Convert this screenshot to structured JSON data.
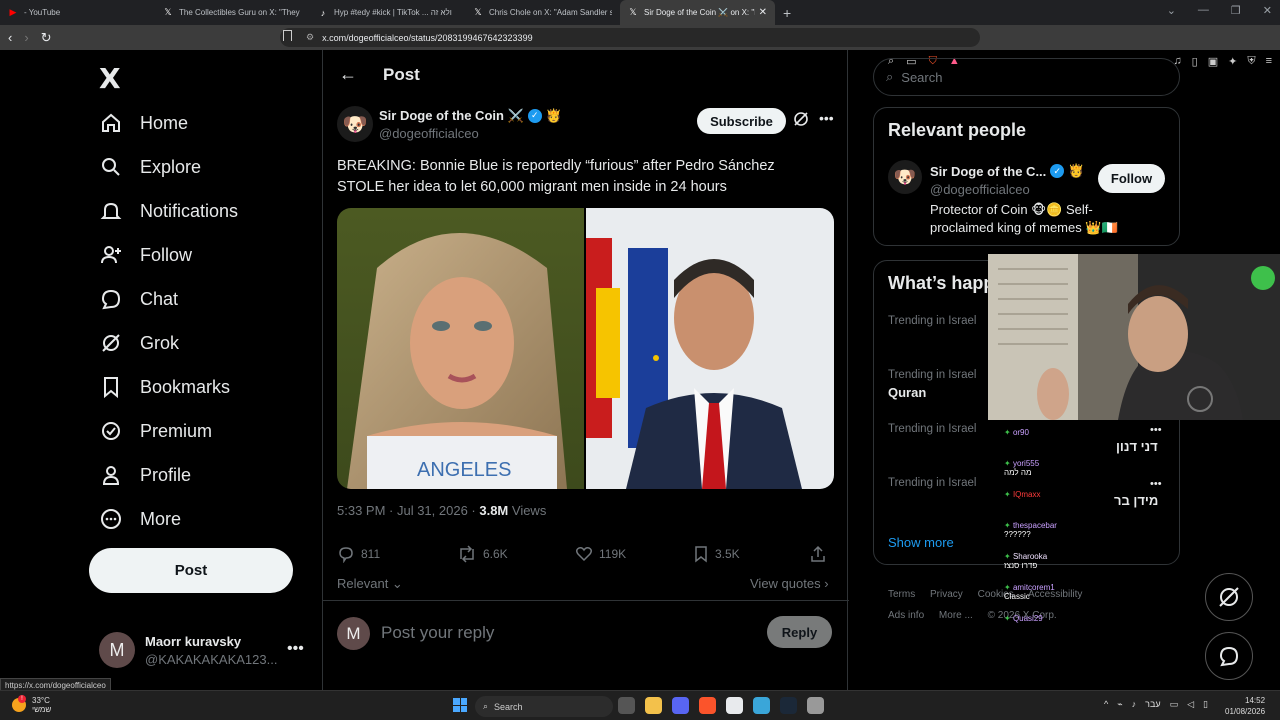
{
  "browser": {
    "tabs": [
      {
        "title": "- YouTube",
        "icon": "youtube-icon",
        "color": "#ff0000"
      },
      {
        "title": "The Collectibles Guru on X: \"They re...",
        "icon": "x-icon",
        "color": "#ffffff"
      },
      {
        "title": "Hyp #tedy #kick | TikTok ... ולא זה",
        "icon": "tiktok-icon",
        "color": "#ffffff"
      },
      {
        "title": "Chris Chole on X: \"Adam Sandler sha...",
        "icon": "x-icon",
        "color": "#ffffff"
      },
      {
        "title": "Sir Doge of the Coin ⚔️ on X: \"B...",
        "icon": "x-icon",
        "color": "#ffffff",
        "active": true
      }
    ],
    "new_tab": "+",
    "url": "x.com/dogeofficialceo/status/2083199467642323399",
    "status_url": "https://x.com/dogeofficialceo"
  },
  "nav": {
    "logo": "X",
    "items": [
      {
        "label": "Home",
        "icon": "home-icon"
      },
      {
        "label": "Explore",
        "icon": "search-icon"
      },
      {
        "label": "Notifications",
        "icon": "bell-icon"
      },
      {
        "label": "Follow",
        "icon": "person-add-icon"
      },
      {
        "label": "Chat",
        "icon": "chat-icon"
      },
      {
        "label": "Grok",
        "icon": "grok-icon"
      },
      {
        "label": "Bookmarks",
        "icon": "bookmark-icon"
      },
      {
        "label": "Premium",
        "icon": "verified-badge-icon"
      },
      {
        "label": "Profile",
        "icon": "person-icon"
      },
      {
        "label": "More",
        "icon": "more-circle-icon"
      }
    ],
    "post_label": "Post",
    "account": {
      "initial": "M",
      "name": "Maorr kuravsky",
      "handle": "@KAKAKAKAKA123..."
    }
  },
  "post": {
    "header": "Post",
    "author": {
      "name": "Sir Doge of the Coin ⚔️",
      "badge_emoji": "🫅",
      "handle": "@dogeofficialceo"
    },
    "subscribe_label": "Subscribe",
    "text": "BREAKING: Bonnie Blue is reportedly “furious” after Pedro Sánchez STOLE her idea to let 60,000 migrant men inside in 24 hours",
    "time": "5:33 PM · Jul 31, 2026 · ",
    "views_count": "3.8M",
    "views_label": " Views",
    "stats": {
      "replies": "811",
      "reposts": "6.6K",
      "likes": "119K",
      "bookmarks": "3.5K"
    },
    "relevant_label": "Relevant",
    "view_quotes_label": "View quotes",
    "reply_placeholder": "Post your reply",
    "reply_label": "Reply",
    "reply_initial": "M"
  },
  "sidebar": {
    "search_placeholder": "Search",
    "relevant_title": "Relevant people",
    "person": {
      "name": "Sir Doge of the C...",
      "handle": "@dogeofficialceo",
      "bio": "Protector of Coin 🐵🪙 Self-proclaimed king of memes 👑🇮🇪",
      "follow_label": "Follow"
    },
    "happening_title": "What’s happ",
    "trends": [
      {
        "context": "Trending in Israel",
        "name": ""
      },
      {
        "context": "Trending in Israel",
        "name": "Quran"
      },
      {
        "context": "Trending in Israel",
        "name": "דני דנון"
      },
      {
        "context": "Trending in Israel",
        "name": "מידן בר"
      }
    ],
    "show_more": "Show more",
    "footer": [
      "Terms",
      "Privacy",
      "Cookies",
      "Accessibility",
      "Ads info",
      "More ...",
      "© 2026 X Corp."
    ]
  },
  "stream_chat": [
    {
      "user": "or90",
      "text": "",
      "color": "#c9a0ff"
    },
    {
      "user": "yori555",
      "text": "מה למה",
      "color": "#c9a0ff"
    },
    {
      "user": "IQmaxx",
      "text": "",
      "color": "#ff3b3b"
    },
    {
      "user": "thespacebar",
      "text": "??????",
      "color": "#c9a0ff"
    },
    {
      "user": "Sharooka",
      "text": "פדרו סנצז",
      "color": "#f0e1ff"
    },
    {
      "user": "amitcorem1",
      "text": "Classic",
      "color": "#c9a0ff"
    },
    {
      "user": "Quasi29",
      "text": "",
      "color": "#c9a0ff"
    }
  ],
  "taskbar": {
    "temp": "33°C",
    "weather_sub": "שמשי",
    "search_label": "Search",
    "lang": "עבר",
    "time": "14:52",
    "date": "01/08/2026"
  }
}
